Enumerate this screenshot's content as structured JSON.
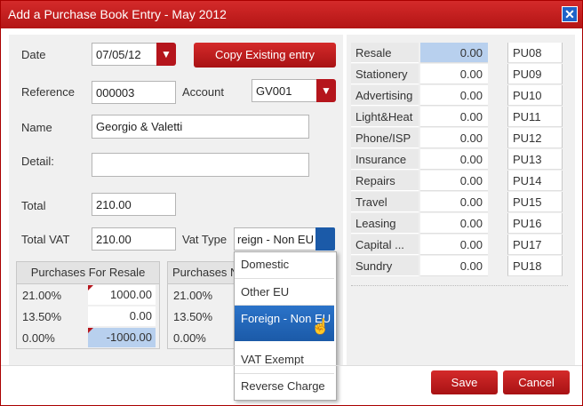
{
  "window": {
    "title": "Add a Purchase Book Entry - May 2012",
    "close_icon": "close-icon"
  },
  "form": {
    "date_label": "Date",
    "date_value": "07/05/12",
    "copy_button": "Copy Existing entry",
    "reference_label": "Reference",
    "reference_value": "000003",
    "account_label": "Account",
    "account_value": "GV001",
    "name_label": "Name",
    "name_value": "Georgio & Valetti",
    "detail_label": "Detail:",
    "detail_value": "",
    "total_label": "Total",
    "total_value": "210.00",
    "total_vat_label": "Total VAT",
    "total_vat_value": "210.00",
    "vat_type_label": "Vat Type",
    "vat_type_value": "reign - Non EU"
  },
  "vat_tables": [
    {
      "header": "Purchases For Resale",
      "rows": [
        {
          "rate": "21.00%",
          "value": "1000.00"
        },
        {
          "rate": "13.50%",
          "value": "0.00"
        },
        {
          "rate": "0.00%",
          "value": "-1000.00"
        }
      ]
    },
    {
      "header": "Purchases N",
      "rows": [
        {
          "rate": "21.00%"
        },
        {
          "rate": "13.50%"
        },
        {
          "rate": "0.00%"
        }
      ]
    }
  ],
  "vat_dropdown": {
    "options": [
      "Domestic",
      "Other EU",
      "Foreign - Non EU",
      "VAT Exempt",
      "Reverse Charge"
    ],
    "selected": "Foreign - Non EU"
  },
  "accounts": [
    {
      "name": "Resale",
      "value": "0.00",
      "code": "PU08"
    },
    {
      "name": "Stationery",
      "value": "0.00",
      "code": "PU09"
    },
    {
      "name": "Advertising",
      "value": "0.00",
      "code": "PU10"
    },
    {
      "name": "Light&Heat",
      "value": "0.00",
      "code": "PU11"
    },
    {
      "name": "Phone/ISP",
      "value": "0.00",
      "code": "PU12"
    },
    {
      "name": "Insurance",
      "value": "0.00",
      "code": "PU13"
    },
    {
      "name": "Repairs",
      "value": "0.00",
      "code": "PU14"
    },
    {
      "name": "Travel",
      "value": "0.00",
      "code": "PU15"
    },
    {
      "name": "Leasing",
      "value": "0.00",
      "code": "PU16"
    },
    {
      "name": "Capital ...",
      "value": "0.00",
      "code": "PU17"
    },
    {
      "name": "Sundry",
      "value": "0.00",
      "code": "PU18"
    }
  ],
  "footer": {
    "save": "Save",
    "cancel": "Cancel"
  },
  "colors": {
    "brand_red": "#b5151c",
    "selection_blue": "#1b5aa8",
    "highlight_blue": "#b8d0ee"
  }
}
